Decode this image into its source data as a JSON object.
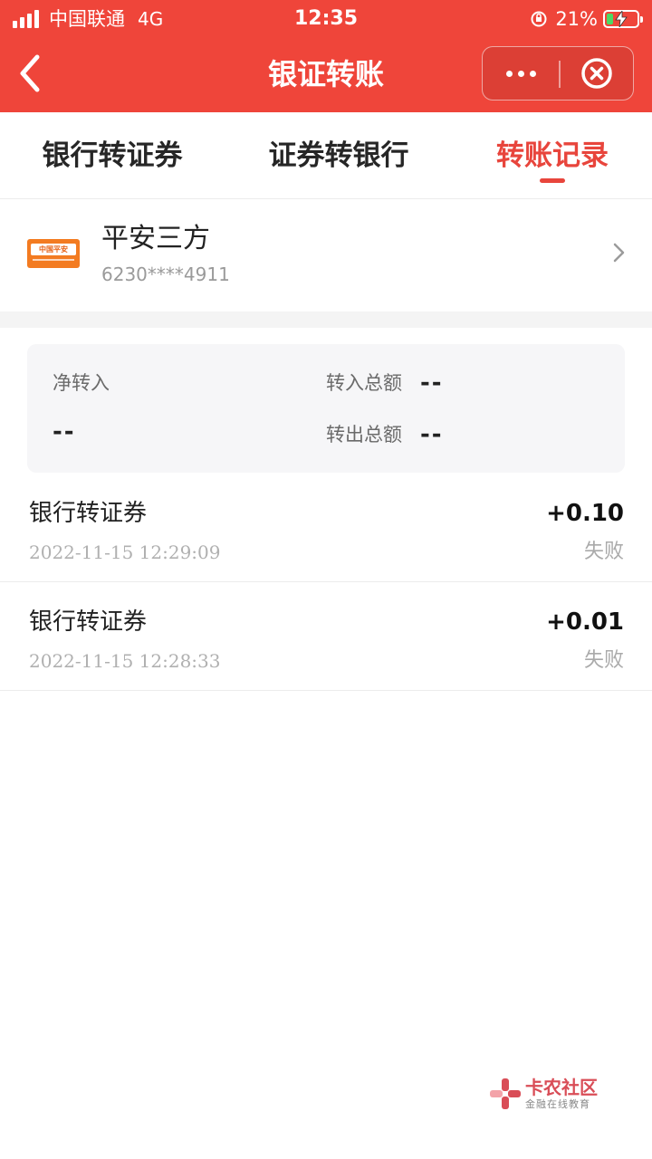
{
  "status_bar": {
    "carrier": "中国联通",
    "network": "4G",
    "time": "12:35",
    "battery_percent": "21%",
    "battery_level": 0.21,
    "battery_fill_color": "#4cd964"
  },
  "nav": {
    "title": "银证转账",
    "back_icon": "chevron-left-icon",
    "more_icon": "more-dots-icon",
    "close_icon": "close-circle-icon",
    "background_color": "#ef453a"
  },
  "tabs": [
    {
      "label": "银行转证券",
      "active": false
    },
    {
      "label": "证券转银行",
      "active": false
    },
    {
      "label": "转账记录",
      "active": true
    }
  ],
  "accent_color": "#e8453c",
  "account": {
    "bank_logo_text": "中国平安",
    "name": "平安三方",
    "number": "6230****4911"
  },
  "summary": {
    "net_in_label": "净转入",
    "net_in_value": "--",
    "total_in_label": "转入总额",
    "total_in_value": "--",
    "total_out_label": "转出总额",
    "total_out_value": "--"
  },
  "records": [
    {
      "title": "银行转证券",
      "time": "2022-11-15 12:29:09",
      "amount": "+0.10",
      "status": "失败"
    },
    {
      "title": "银行转证券",
      "time": "2022-11-15 12:28:33",
      "amount": "+0.01",
      "status": "失败"
    }
  ],
  "watermark": {
    "title": "卡农社区",
    "subtitle": "金融在线教育"
  }
}
